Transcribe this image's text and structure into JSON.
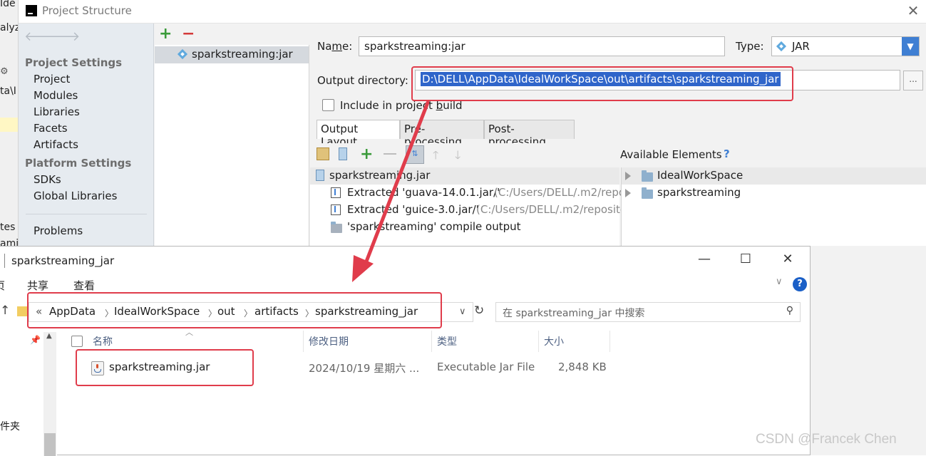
{
  "ide": {
    "strip_texts": [
      "Ide",
      "alyz",
      "ta\\I",
      "tes",
      "ami"
    ],
    "title": "Project Structure",
    "close_glyph": "✕",
    "nav_back": "🡐",
    "nav_fwd": "🡒",
    "sections": [
      {
        "heading": "Project Settings",
        "items": [
          "Project",
          "Modules",
          "Libraries",
          "Facets",
          "Artifacts"
        ]
      },
      {
        "heading": "Platform Settings",
        "items": [
          "SDKs",
          "Global Libraries"
        ]
      }
    ],
    "problems": "Problems",
    "artifact_name": "sparkstreaming:jar",
    "form": {
      "name_label_pre": "Na",
      "name_label_u": "m",
      "name_label_post": "e:",
      "name_value": "sparkstreaming:jar",
      "type_label": "Type:",
      "type_value": "JAR",
      "output_label": "Output directory:",
      "output_value": "D:\\DELL\\AppData\\IdealWorkSpace\\out\\artifacts\\sparkstreaming_jar",
      "browse": "...",
      "include_label_pre": "Include in project ",
      "include_label_u": "b",
      "include_label_post": "uild"
    },
    "tabs": [
      "Output Layout",
      "Pre-processing",
      "Post-processing"
    ],
    "available_label": "Available Elements",
    "available_help": "?",
    "tree": {
      "root": "sparkstreaming.jar",
      "items": [
        {
          "name": "Extracted 'guava-14.0.1.jar/'",
          "path": "(C:/Users/DELL/.m2/repo"
        },
        {
          "name": "Extracted 'guice-3.0.jar/'",
          "path": "(C:/Users/DELL/.m2/reposito"
        },
        {
          "name": "'sparkstreaming' compile output",
          "path": ""
        }
      ]
    },
    "available": [
      "IdealWorkSpace",
      "sparkstreaming"
    ]
  },
  "explorer": {
    "title": "sparkstreaming_jar",
    "minimize": "—",
    "maximize": "☐",
    "close": "✕",
    "menu": [
      "页",
      "共享",
      "查看"
    ],
    "help": "?",
    "breadcrumb_prefix": "«",
    "breadcrumb": [
      "AppData",
      "IdealWorkSpace",
      "out",
      "artifacts",
      "sparkstreaming_jar"
    ],
    "search_placeholder": "在 sparkstreaming_jar 中搜索",
    "columns": [
      "名称",
      "修改日期",
      "类型",
      "大小"
    ],
    "nav_items": [
      "件夹"
    ],
    "file": {
      "name": "sparkstreaming.jar",
      "date": "2024/10/19 星期六 ...",
      "type": "Executable Jar File",
      "size": "2,848 KB"
    }
  },
  "watermark": "CSDN @Francek Chen",
  "colors": {
    "highlight_red": "#e03c4b",
    "selection_blue": "#2f65ca",
    "accent_blue": "#3f7fd3"
  }
}
